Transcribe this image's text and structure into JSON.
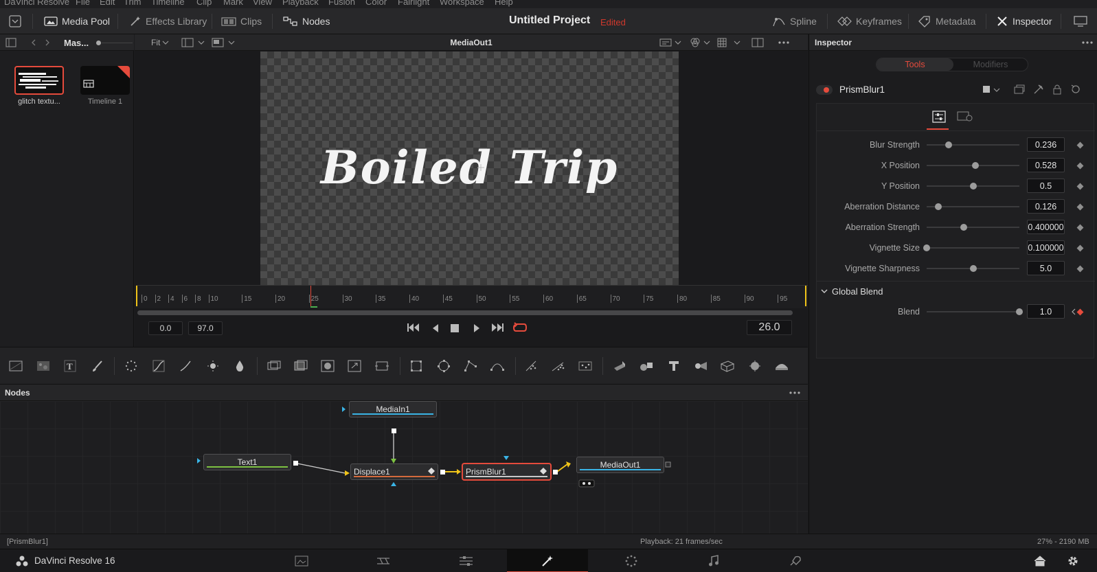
{
  "menu": {
    "items": [
      "DaVinci Resolve",
      "File",
      "Edit",
      "Trim",
      "Timeline",
      "Clip",
      "Mark",
      "View",
      "Playback",
      "Fusion",
      "Color",
      "Fairlight",
      "Workspace",
      "Help"
    ]
  },
  "toolbar": {
    "media_pool": "Media Pool",
    "effects_library": "Effects Library",
    "clips": "Clips",
    "nodes": "Nodes",
    "project_title": "Untitled Project",
    "project_status": "Edited",
    "spline": "Spline",
    "keyframes": "Keyframes",
    "metadata": "Metadata",
    "inspector": "Inspector"
  },
  "media_pool": {
    "bin_name": "Mas...",
    "clips": [
      {
        "name": "glitch textu...",
        "selected": true
      },
      {
        "name": "Timeline 1",
        "selected": false
      }
    ]
  },
  "viewer": {
    "zoom": "Fit",
    "title": "MediaOut1",
    "canvas_text": "Boiled Trip",
    "ruler_labels": [
      "0",
      "2",
      "4",
      "6",
      "8",
      "10",
      "15",
      "20",
      "25",
      "30",
      "35",
      "40",
      "45",
      "50",
      "55",
      "60",
      "65",
      "70",
      "75",
      "80",
      "85",
      "90",
      "95"
    ],
    "start_frame": "0.0",
    "end_frame": "97.0",
    "current_frame": "26.0"
  },
  "nodes": {
    "panel_title": "Nodes",
    "media_in": "MediaIn1",
    "text": "Text1",
    "displace": "Displace1",
    "prism_blur": "PrismBlur1",
    "media_out": "MediaOut1"
  },
  "inspector": {
    "title": "Inspector",
    "tab_tools": "Tools",
    "tab_modifiers": "Modifiers",
    "tool_name": "PrismBlur1",
    "params": [
      {
        "label": "Blur Strength",
        "value": "0.236",
        "level": 0.236
      },
      {
        "label": "X Position",
        "value": "0.528",
        "level": 0.528
      },
      {
        "label": "Y Position",
        "value": "0.5",
        "level": 0.5
      },
      {
        "label": "Aberration Distance",
        "value": "0.126",
        "level": 0.126
      },
      {
        "label": "Aberration Strength",
        "value": "0.400000",
        "level": 0.4
      },
      {
        "label": "Vignette Size",
        "value": "0.100000",
        "level": 0.0
      },
      {
        "label": "Vignette Sharpness",
        "value": "5.0",
        "level": 0.5
      }
    ],
    "global_blend_label": "Global Blend",
    "blend_label": "Blend",
    "blend_value": "1.0",
    "blend_level": 1.0
  },
  "status": {
    "selection": "[PrismBlur1]",
    "playback": "Playback: 21 frames/sec",
    "memory": "27% - 2190 MB"
  },
  "app": {
    "name": "DaVinci Resolve 16"
  },
  "colors": {
    "accent_red": "#e64b3c",
    "text_green": "#7dc242",
    "link_yellow": "#f0c419",
    "marker_blue": "#3ab4e6"
  }
}
